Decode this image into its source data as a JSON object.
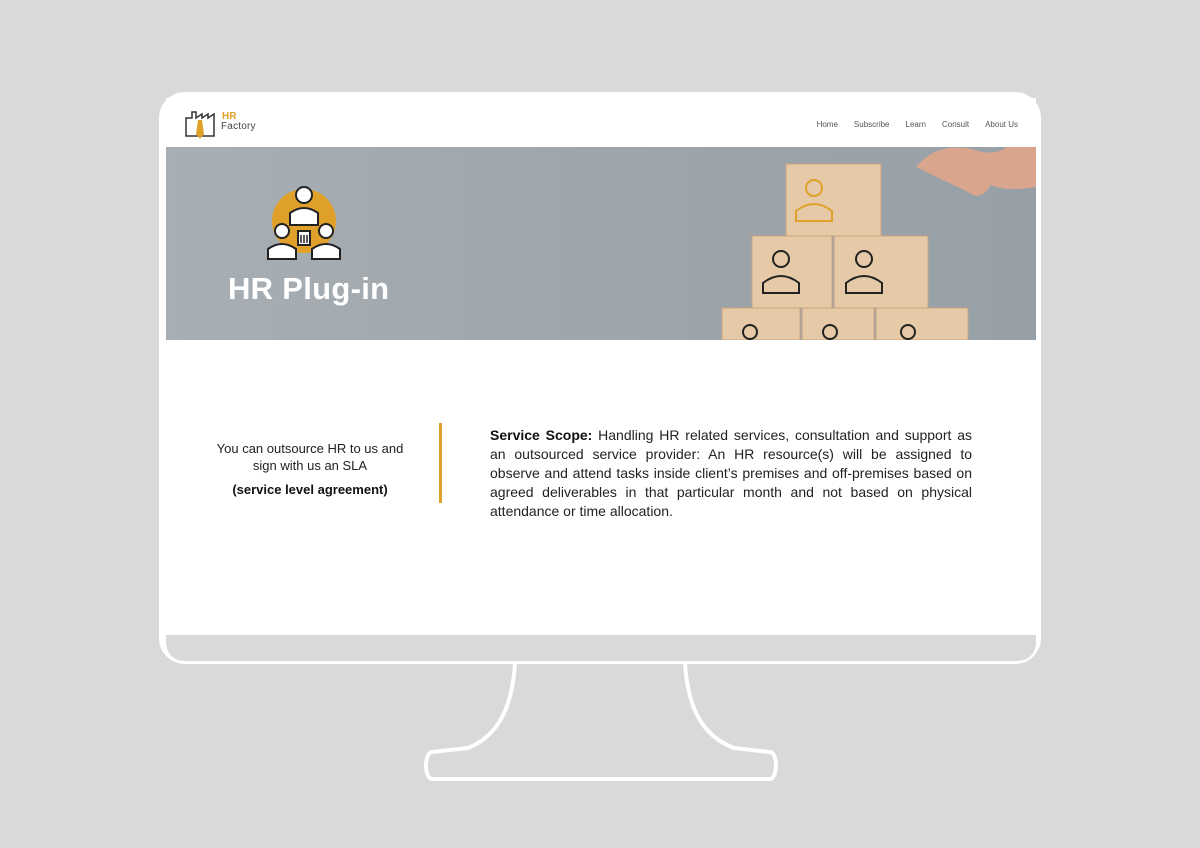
{
  "logo": {
    "line1": "HR",
    "line2": "Factory"
  },
  "nav": {
    "items": [
      {
        "label": "Home"
      },
      {
        "label": "Subscribe"
      },
      {
        "label": "Learn"
      },
      {
        "label": "Consult"
      },
      {
        "label": "About Us"
      }
    ]
  },
  "hero": {
    "title": "HR Plug-in",
    "icon": "team-group-icon",
    "image": "wooden-blocks-people-icon"
  },
  "content": {
    "left_text": "You can outsource HR to us and sign with us an SLA",
    "left_bold": "(service level agreement)",
    "scope_label": "Service Scope:",
    "scope_text": " Handling HR related services, consultation and support as an outsourced service provider:   An HR resource(s) will be assigned to observe and attend tasks inside client’s premises and off-premises based on agreed deliverables in that particular month and not based on physical attendance or time allocation."
  },
  "colors": {
    "accent": "#e0a12a",
    "background": "#d9d9d9",
    "hero": "#a0a8ae"
  }
}
